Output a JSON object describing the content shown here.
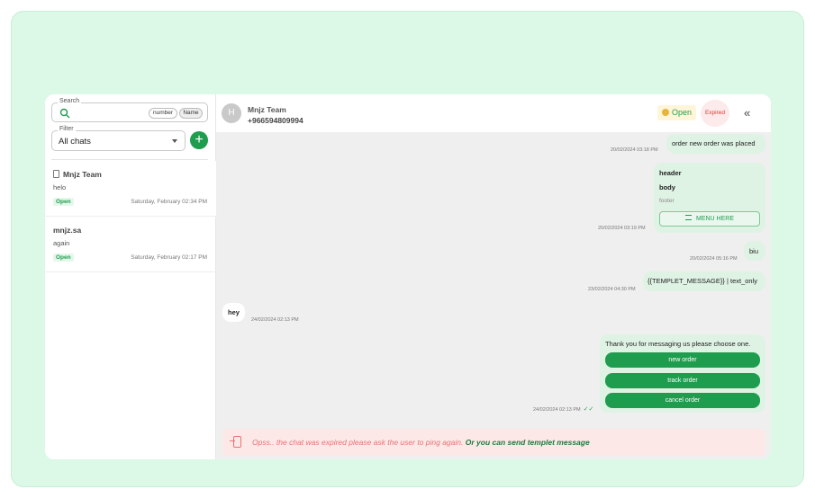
{
  "sidebar": {
    "search": {
      "legend": "Search",
      "chip_number": "number",
      "chip_name": "Name"
    },
    "filter": {
      "legend": "Filter",
      "value": "All chats"
    },
    "add_label": "+",
    "chats": [
      {
        "title": "Mnjz Team",
        "preview": "helo",
        "status": "Open",
        "time": "Saturday, February 02:34 PM"
      },
      {
        "title": "mnjz.sa",
        "preview": "again",
        "status": "Open",
        "time": "Saturday, February 02:17 PM"
      }
    ]
  },
  "header": {
    "avatar_letter": "H",
    "name": "Mnjz Team",
    "phone": "+966594809994",
    "open_label": "Open",
    "expired_label": "Expired",
    "collapse_icon": "«"
  },
  "messages": {
    "m1": {
      "text": "order new order was placed",
      "time": "20/02/2024 03:18 PM"
    },
    "m2": {
      "header": "header",
      "body": "body",
      "footer": "footer",
      "menu": "MENU HERE",
      "time": "20/02/2024 03:19 PM"
    },
    "m3": {
      "text": "biu",
      "time": "20/02/2024 05:16 PM"
    },
    "m4": {
      "text": "{{TEMPLET_MESSAGE}} | text_only",
      "time": "23/02/2024 04:30 PM"
    },
    "m5": {
      "text": "hey",
      "time": "24/02/2024 02:13 PM"
    },
    "m6": {
      "text": "Thank you for messaging us please choose one.",
      "options": [
        "new order",
        "track order",
        "cancel order"
      ],
      "time": "24/02/2024 02:13 PM",
      "read_icon": "✓✓"
    }
  },
  "expired_notice": {
    "text": "Opss.. the chat was expired please ask the user to ping again.",
    "link": "Or you can send templet message"
  },
  "colors": {
    "accent": "#1f9d4e",
    "outgoing": "#dff3e5",
    "expired": "#e57373"
  }
}
